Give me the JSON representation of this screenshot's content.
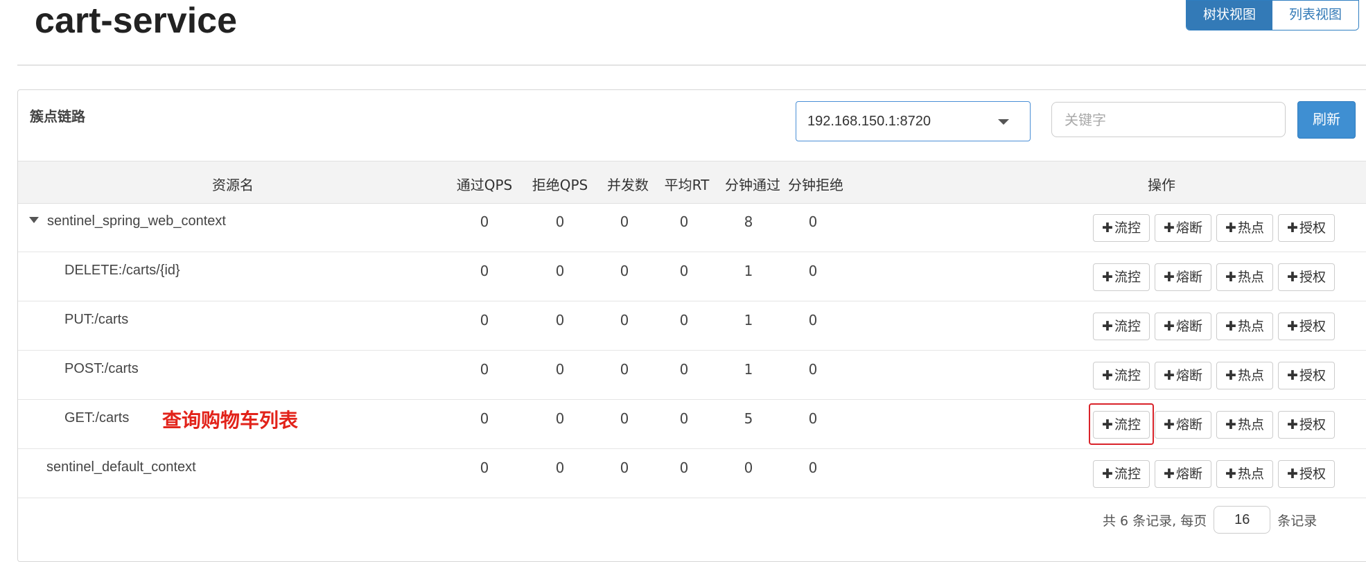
{
  "app": {
    "title": "cart-service"
  },
  "view_toggle": {
    "tree": "树状视图",
    "list": "列表视图"
  },
  "panel": {
    "title": "簇点链路",
    "machine_select": "192.168.150.1:8720",
    "keyword_placeholder": "关键字",
    "refresh_label": "刷新"
  },
  "table": {
    "headers": [
      "资源名",
      "通过QPS",
      "拒绝QPS",
      "并发数",
      "平均RT",
      "分钟通过",
      "分钟拒绝",
      "操作"
    ],
    "rows": [
      {
        "name": "sentinel_spring_web_context",
        "level": 0,
        "expanded": true,
        "pass_qps": "0",
        "block_qps": "0",
        "concurrency": "0",
        "avg_rt": "0",
        "minute_pass": "8",
        "minute_block": "0"
      },
      {
        "name": "DELETE:/carts/{id}",
        "level": 1,
        "pass_qps": "0",
        "block_qps": "0",
        "concurrency": "0",
        "avg_rt": "0",
        "minute_pass": "1",
        "minute_block": "0"
      },
      {
        "name": "PUT:/carts",
        "level": 1,
        "pass_qps": "0",
        "block_qps": "0",
        "concurrency": "0",
        "avg_rt": "0",
        "minute_pass": "1",
        "minute_block": "0"
      },
      {
        "name": "POST:/carts",
        "level": 1,
        "pass_qps": "0",
        "block_qps": "0",
        "concurrency": "0",
        "avg_rt": "0",
        "minute_pass": "1",
        "minute_block": "0"
      },
      {
        "name": "GET:/carts",
        "level": 1,
        "annotation": "查询购物车列表",
        "pass_qps": "0",
        "block_qps": "0",
        "concurrency": "0",
        "avg_rt": "0",
        "minute_pass": "5",
        "minute_block": "0"
      },
      {
        "name": "sentinel_default_context",
        "level": 0,
        "pass_qps": "0",
        "block_qps": "0",
        "concurrency": "0",
        "avg_rt": "0",
        "minute_pass": "0",
        "minute_block": "0"
      }
    ],
    "actions": {
      "flow": "流控",
      "degrade": "熔断",
      "hotspot": "热点",
      "auth": "授权",
      "plus": "✚"
    }
  },
  "pagination": {
    "prefix": "共 6 条记录, 每页",
    "page_size": "16",
    "suffix": "条记录"
  },
  "colors": {
    "primary": "#337ab7",
    "annotation": "#e2231a",
    "highlight": "#d9232a"
  }
}
